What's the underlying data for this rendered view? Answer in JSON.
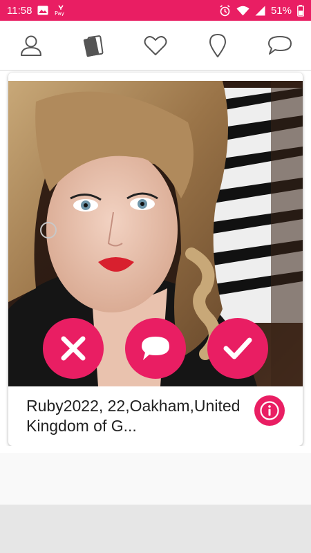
{
  "status_bar": {
    "time": "11:58",
    "battery": "51%",
    "background": "#e91e63",
    "icons": [
      "image-icon",
      "pay-app-icon",
      "alarm-icon",
      "wifi-icon",
      "signal-icon",
      "battery-icon"
    ],
    "pay_label": "Pay"
  },
  "nav": {
    "items": [
      {
        "icon": "profile-icon"
      },
      {
        "icon": "cards-icon"
      },
      {
        "icon": "heart-icon"
      },
      {
        "icon": "location-pin-icon"
      },
      {
        "icon": "chat-bubble-icon"
      }
    ]
  },
  "profile_card": {
    "text": "Ruby2022, 22,Oakham,United Kingdom of G...",
    "photo_icon": "profile-photo"
  },
  "actions": [
    {
      "icon": "dislike-x-icon"
    },
    {
      "icon": "message-icon"
    },
    {
      "icon": "like-check-icon"
    }
  ],
  "info_icon": "info-icon",
  "colors": {
    "accent": "#e91e63",
    "nav_icon": "#555555",
    "text": "#222222"
  }
}
